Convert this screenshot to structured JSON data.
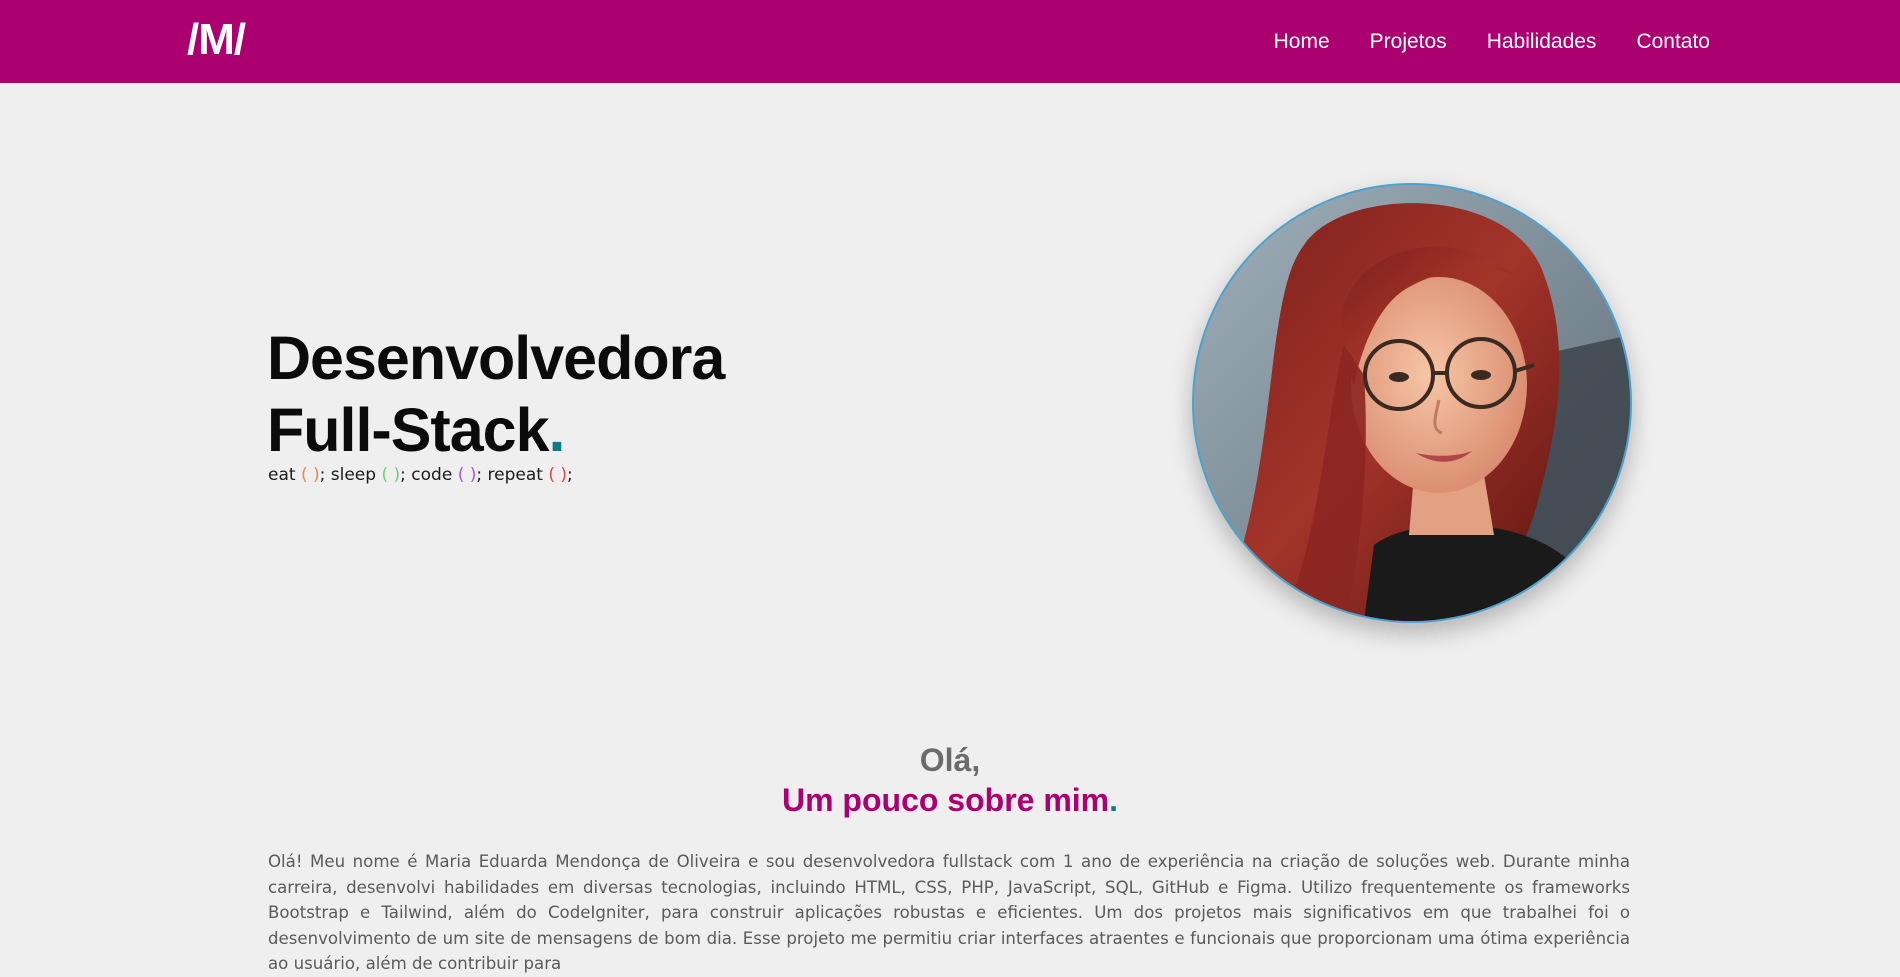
{
  "brand": {
    "logo": "/M/"
  },
  "nav": {
    "items": [
      {
        "label": "Home"
      },
      {
        "label": "Projetos"
      },
      {
        "label": "Habilidades"
      },
      {
        "label": "Contato"
      }
    ]
  },
  "hero": {
    "title_line1": "Desenvolvedora",
    "title_line2": "Full-Stack",
    "title_dot": ".",
    "tagline": {
      "eat": "eat",
      "sleep": "sleep",
      "code": "code",
      "repeat": "repeat",
      "parens": "( )",
      "sep": ";"
    }
  },
  "about": {
    "greeting": "Olá,",
    "subtitle": "Um pouco sobre mim",
    "subtitle_dot": ".",
    "text": "Olá! Meu nome é Maria Eduarda Mendonça de Oliveira e sou desenvolvedora fullstack com 1 ano de experiência na criação de soluções web. Durante minha carreira, desenvolvi habilidades em diversas tecnologias, incluindo HTML, CSS, PHP, JavaScript, SQL, GitHub e Figma. Utilizo frequentemente os frameworks Bootstrap e Tailwind, além do CodeIgniter, para construir aplicações robustas e eficientes. Um dos projetos mais significativos em que trabalhei foi o desenvolvimento de um site de mensagens de bom dia. Esse projeto me permitiu criar interfaces atraentes e funcionais que proporcionam uma ótima experiência ao usuário, além de contribuir para"
  },
  "colors": {
    "brand": "#ac0070",
    "accent_dot": "#0d7a8c",
    "background": "#efefef"
  }
}
